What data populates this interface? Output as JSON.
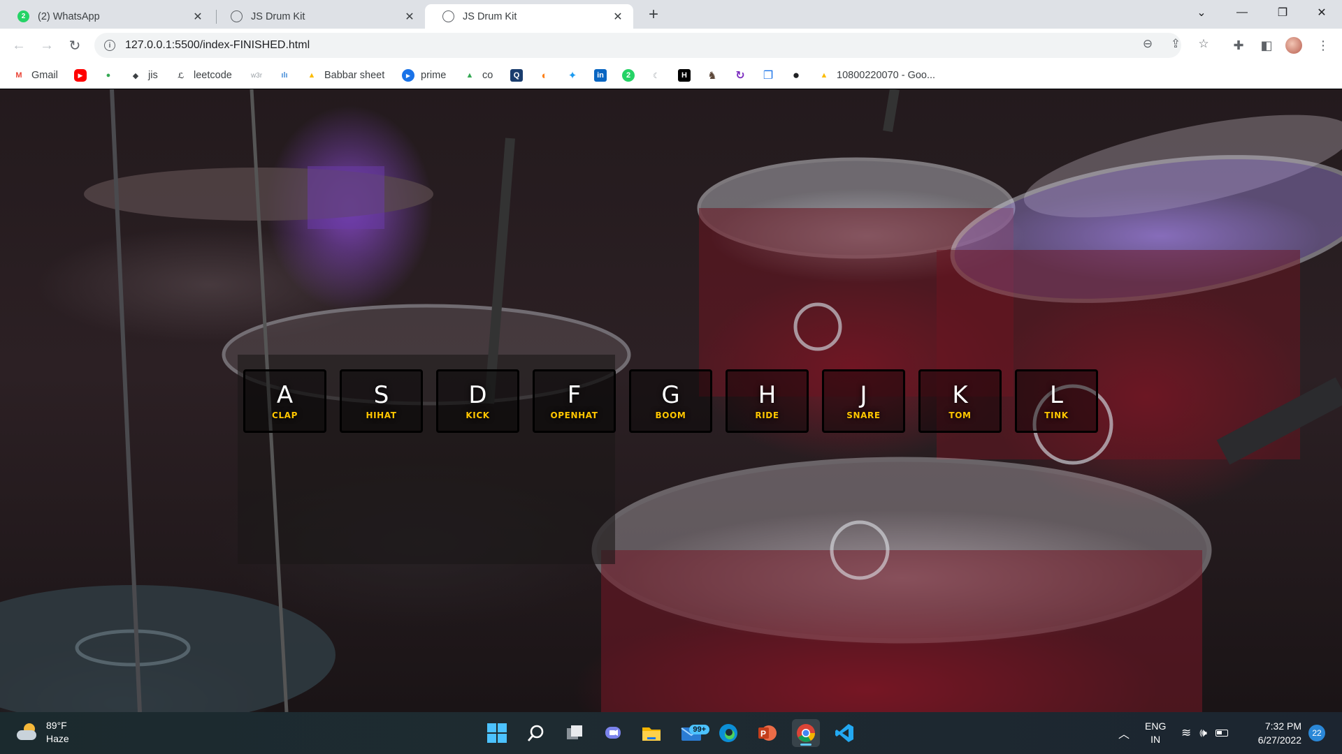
{
  "browser": {
    "tabs": [
      {
        "title": "(2) WhatsApp",
        "favicon": "whatsapp-icon",
        "favicon_text": "2"
      },
      {
        "title": "JS Drum Kit",
        "favicon": "globe-icon"
      },
      {
        "title": "JS Drum Kit",
        "favicon": "globe-icon",
        "active": true
      }
    ],
    "new_tab_label": "+",
    "address": "127.0.0.1:5500/index-FINISHED.html"
  },
  "bookmarks": [
    {
      "label": "Gmail",
      "icon": "gmail-icon",
      "glyph": "M",
      "color": "#ea4335"
    },
    {
      "label": "",
      "icon": "youtube-icon",
      "glyph": "▶",
      "color": "#ff0000"
    },
    {
      "label": "",
      "icon": "maps-icon",
      "glyph": "●",
      "color": "#34a853"
    },
    {
      "label": "jis",
      "icon": "diamond-icon",
      "glyph": "◆",
      "color": "#202124"
    },
    {
      "label": "leetcode",
      "icon": "leetcode-icon",
      "glyph": "ℒ",
      "color": "#202124"
    },
    {
      "label": "",
      "icon": "w3schools-icon",
      "glyph": "w3r",
      "color": "#9aa0a6"
    },
    {
      "label": "",
      "icon": "chart-icon",
      "glyph": "ılı",
      "color": "#4a90d9"
    },
    {
      "label": "Babbar sheet",
      "icon": "drive-icon",
      "glyph": "▲",
      "color": "#fbbc04"
    },
    {
      "label": "prime",
      "icon": "prime-icon",
      "glyph": "▶",
      "color": "#1a73e8"
    },
    {
      "label": "co",
      "icon": "drive-icon",
      "glyph": "▲",
      "color": "#34a853"
    },
    {
      "label": "",
      "icon": "search-box-icon",
      "glyph": "Q",
      "color": "#1a73e8"
    },
    {
      "label": "",
      "icon": "swiggy-icon",
      "glyph": "◐",
      "color": "#fc8019"
    },
    {
      "label": "",
      "icon": "twitter-icon",
      "glyph": "✦",
      "color": "#1d9bf0"
    },
    {
      "label": "",
      "icon": "linkedin-icon",
      "glyph": "in",
      "color": "#0a66c2"
    },
    {
      "label": "",
      "icon": "whatsapp-icon",
      "glyph": "2",
      "color": "#25d366"
    },
    {
      "label": "",
      "icon": "moon-icon",
      "glyph": "☾",
      "color": "#9aa0a6"
    },
    {
      "label": "",
      "icon": "hackerrank-icon",
      "glyph": "H",
      "color": "#000000"
    },
    {
      "label": "",
      "icon": "codechef-icon",
      "glyph": "♞",
      "color": "#5b4638"
    },
    {
      "label": "",
      "icon": "refresh-app-icon",
      "glyph": "↻",
      "color": "#7b2cbf"
    },
    {
      "label": "",
      "icon": "copy-app-icon",
      "glyph": "❐",
      "color": "#1a73e8"
    },
    {
      "label": "",
      "icon": "github-icon",
      "glyph": "●",
      "color": "#202124"
    },
    {
      "label": "10800220070 - Goo...",
      "icon": "drive-icon",
      "glyph": "▲",
      "color": "#fbbc04"
    }
  ],
  "drumkit": {
    "keys": [
      {
        "key": "A",
        "sound": "clap"
      },
      {
        "key": "S",
        "sound": "hihat"
      },
      {
        "key": "D",
        "sound": "kick"
      },
      {
        "key": "F",
        "sound": "openhat"
      },
      {
        "key": "G",
        "sound": "boom"
      },
      {
        "key": "H",
        "sound": "ride"
      },
      {
        "key": "J",
        "sound": "snare"
      },
      {
        "key": "K",
        "sound": "tom"
      },
      {
        "key": "L",
        "sound": "tink"
      }
    ],
    "accent_color": "#ffc600"
  },
  "taskbar": {
    "weather": {
      "temp": "89°F",
      "condition": "Haze"
    },
    "mail_badge": "99+",
    "lang": {
      "line1": "ENG",
      "line2": "IN"
    },
    "clock": {
      "time": "7:32 PM",
      "date": "6/27/2022"
    },
    "notification_count": "22"
  }
}
